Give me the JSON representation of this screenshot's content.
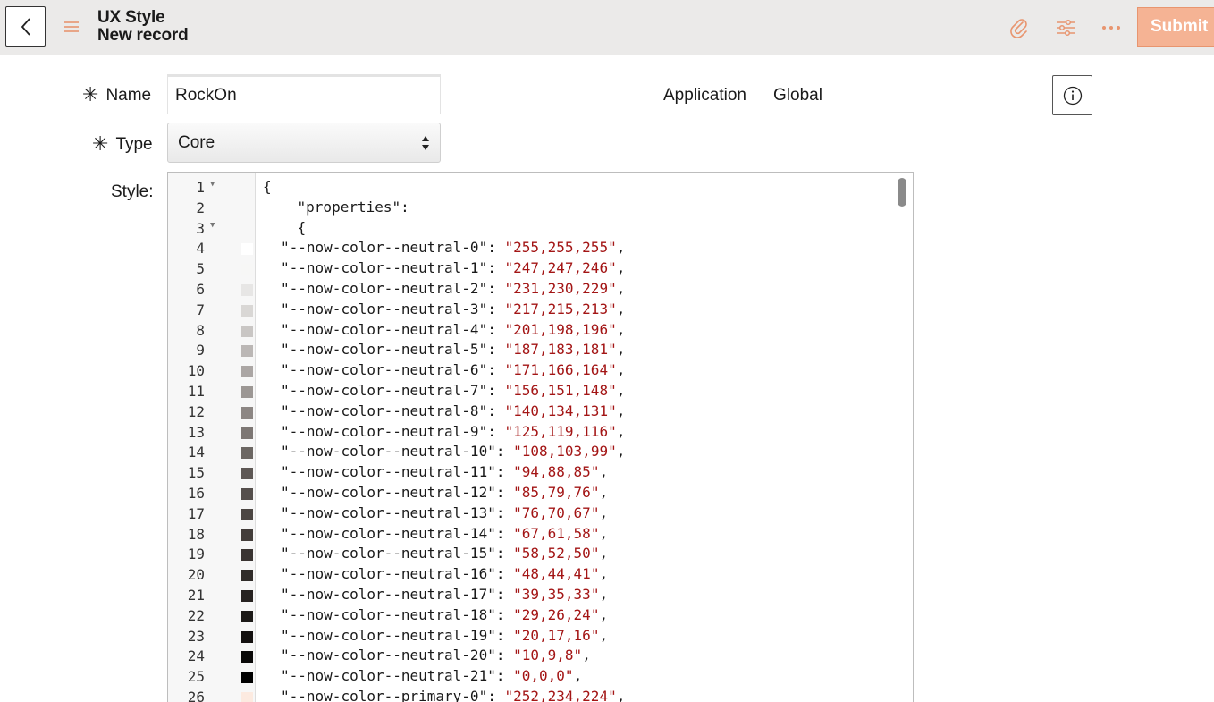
{
  "header": {
    "title_line1": "UX Style",
    "title_line2": "New record",
    "submit_label": "Submit"
  },
  "form": {
    "name_label": "Name",
    "name_value": "RockOn",
    "type_label": "Type",
    "type_value": "Core",
    "application_label": "Application",
    "application_value": "Global",
    "style_label": "Style:",
    "required_mark": "✳"
  },
  "editor": {
    "lines": [
      {
        "n": "1",
        "fold": true,
        "text": "{",
        "swatch": null
      },
      {
        "n": "2",
        "fold": false,
        "text": "    \"properties\":",
        "swatch": null
      },
      {
        "n": "3",
        "fold": true,
        "text": "    {",
        "swatch": null
      },
      {
        "n": "4",
        "key": "--now-color--neutral-0",
        "val": "255,255,255",
        "swatch": "#ffffff"
      },
      {
        "n": "5",
        "key": "--now-color--neutral-1",
        "val": "247,247,246",
        "swatch": "#f7f7f6"
      },
      {
        "n": "6",
        "key": "--now-color--neutral-2",
        "val": "231,230,229",
        "swatch": "#e7e6e5"
      },
      {
        "n": "7",
        "key": "--now-color--neutral-3",
        "val": "217,215,213",
        "swatch": "#d9d7d5"
      },
      {
        "n": "8",
        "key": "--now-color--neutral-4",
        "val": "201,198,196",
        "swatch": "#c9c6c4"
      },
      {
        "n": "9",
        "key": "--now-color--neutral-5",
        "val": "187,183,181",
        "swatch": "#bbb7b5"
      },
      {
        "n": "10",
        "key": "--now-color--neutral-6",
        "val": "171,166,164",
        "swatch": "#aba6a4"
      },
      {
        "n": "11",
        "key": "--now-color--neutral-7",
        "val": "156,151,148",
        "swatch": "#9c9794"
      },
      {
        "n": "12",
        "key": "--now-color--neutral-8",
        "val": "140,134,131",
        "swatch": "#8c8683"
      },
      {
        "n": "13",
        "key": "--now-color--neutral-9",
        "val": "125,119,116",
        "swatch": "#7d7774"
      },
      {
        "n": "14",
        "key": "--now-color--neutral-10",
        "val": "108,103,99",
        "swatch": "#6c6763"
      },
      {
        "n": "15",
        "key": "--now-color--neutral-11",
        "val": "94,88,85",
        "swatch": "#5e5855"
      },
      {
        "n": "16",
        "key": "--now-color--neutral-12",
        "val": "85,79,76",
        "swatch": "#554f4c"
      },
      {
        "n": "17",
        "key": "--now-color--neutral-13",
        "val": "76,70,67",
        "swatch": "#4c4643"
      },
      {
        "n": "18",
        "key": "--now-color--neutral-14",
        "val": "67,61,58",
        "swatch": "#433d3a"
      },
      {
        "n": "19",
        "key": "--now-color--neutral-15",
        "val": "58,52,50",
        "swatch": "#3a3432"
      },
      {
        "n": "20",
        "key": "--now-color--neutral-16",
        "val": "48,44,41",
        "swatch": "#302c29"
      },
      {
        "n": "21",
        "key": "--now-color--neutral-17",
        "val": "39,35,33",
        "swatch": "#272321"
      },
      {
        "n": "22",
        "key": "--now-color--neutral-18",
        "val": "29,26,24",
        "swatch": "#1d1a18"
      },
      {
        "n": "23",
        "key": "--now-color--neutral-19",
        "val": "20,17,16",
        "swatch": "#141110"
      },
      {
        "n": "24",
        "key": "--now-color--neutral-20",
        "val": "10,9,8",
        "swatch": "#0a0908"
      },
      {
        "n": "25",
        "key": "--now-color--neutral-21",
        "val": "0,0,0",
        "swatch": "#000000"
      },
      {
        "n": "26",
        "key": "--now-color--primary-0",
        "val": "252,234,224",
        "swatch": "#fceae0"
      }
    ]
  },
  "colors": {
    "accent": "#f5b394",
    "accent_icon": "#e8956f",
    "header_bg": "#ebeae9",
    "string": "#a31515"
  }
}
